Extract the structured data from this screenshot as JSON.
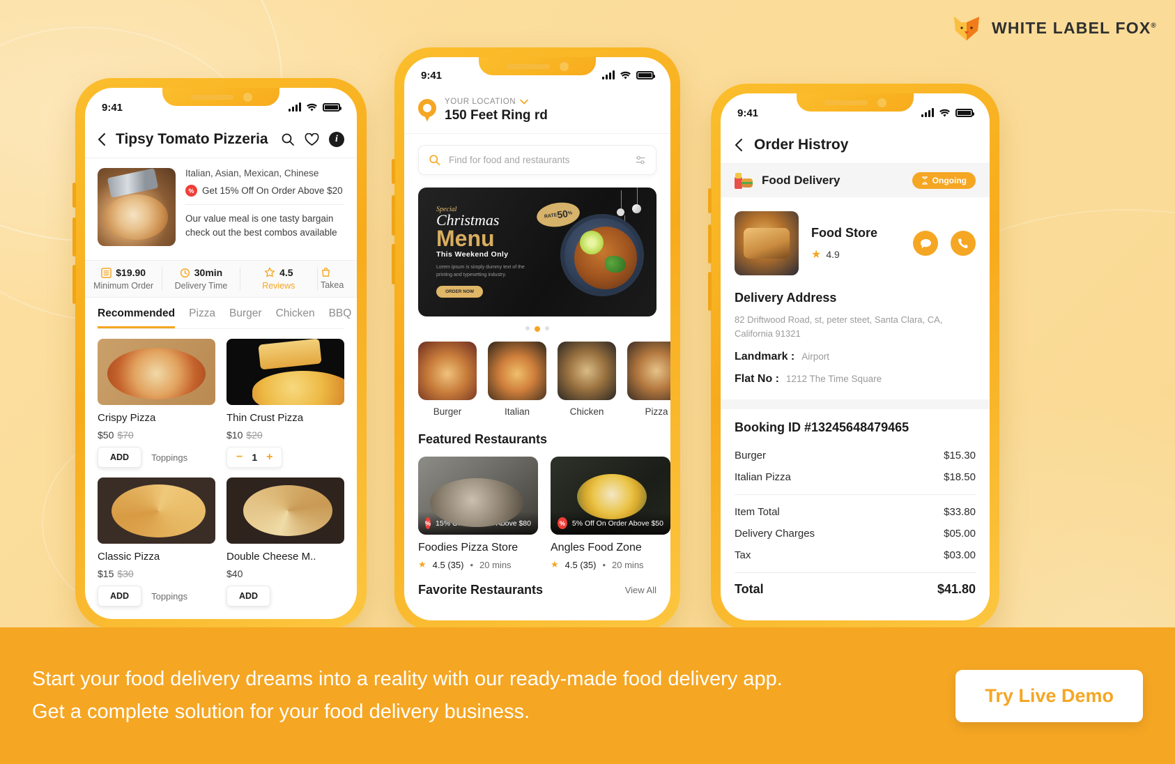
{
  "brand": {
    "name": "WHITE LABEL FOX",
    "trademark": "®"
  },
  "footer": {
    "line1": "Start your food delivery dreams into a reality with our ready-made food delivery app.",
    "line2": "Get a complete solution for your food delivery business.",
    "cta": "Try Live Demo"
  },
  "phone1": {
    "status_time": "9:41",
    "title": "Tipsy Tomato Pizzeria",
    "cuisines": "Italian, Asian, Mexican, Chinese",
    "offer": "Get 15% Off On Order Above $20",
    "description": "Our value meal is one tasty bargain check out the best combos available",
    "stats": [
      {
        "value": "$19.90",
        "label": "Minimum Order",
        "icon": "list-icon"
      },
      {
        "value": "30min",
        "label": "Delivery Time",
        "icon": "clock-icon"
      },
      {
        "value": "4.5",
        "label": "Reviews",
        "icon": "star-icon"
      },
      {
        "value": "",
        "label": "Takea",
        "icon": "bag-icon"
      }
    ],
    "tabs": [
      "Recommended",
      "Pizza",
      "Burger",
      "Chicken",
      "BBQ"
    ],
    "active_tab": "Recommended",
    "dishes": [
      {
        "name": "Crispy Pizza",
        "price": "$50",
        "old_price": "$70",
        "action": "ADD",
        "extra": "Toppings"
      },
      {
        "name": "Thin Crust Pizza",
        "price": "$10",
        "old_price": "$20",
        "action": "stepper",
        "qty": "1"
      },
      {
        "name": "Classic Pizza",
        "price": "$15",
        "old_price": "$30",
        "action": "ADD",
        "extra": "Toppings"
      },
      {
        "name": "Double Cheese M..",
        "price": "$40",
        "old_price": "",
        "action": "ADD",
        "extra": ""
      }
    ]
  },
  "phone2": {
    "status_time": "9:41",
    "location_label": "YOUR LOCATION",
    "location_value": "150 Feet Ring rd",
    "search_placeholder": "Find for food and restaurants",
    "banner": {
      "special": "Special",
      "christmas": "Christmas",
      "menu": "Menu",
      "weekend": "This Weekend Only",
      "lorem": "Lorem ipsum is simply dummy text of the printing and typesetting industry.",
      "button": "ORDER NOW",
      "rate_small": "RATE",
      "rate_big": "50",
      "rate_pct": "%"
    },
    "carousel_dots": 3,
    "carousel_active": 1,
    "categories": [
      {
        "label": "Burger"
      },
      {
        "label": "Italian"
      },
      {
        "label": "Chicken"
      },
      {
        "label": "Pizza"
      }
    ],
    "featured_title": "Featured Restaurants",
    "restaurants": [
      {
        "name": "Foodies Pizza Store",
        "offer": "15% Off On Order Above $80",
        "rating": "4.5 (35)",
        "time": "20 mins"
      },
      {
        "name": "Angles Food Zone",
        "offer": "5% Off On Order Above $50",
        "rating": "4.5 (35)",
        "time": "20 mins"
      }
    ],
    "favorite_title": "Favorite Restaurants",
    "view_all": "View All"
  },
  "phone3": {
    "status_time": "9:41",
    "title": "Order Histroy",
    "order_type": "Food Delivery",
    "status_badge": "Ongoing",
    "store_name": "Food Store",
    "store_rating": "4.9",
    "address_title": "Delivery Address",
    "address_text": "82  Driftwood Road, st, peter steet, Santa Clara, CA, California 91321",
    "landmark_key": "Landmark  :",
    "landmark_value": "Airport",
    "flat_key": "Flat No :",
    "flat_value": "1212 The Time Square",
    "booking_id": "Booking ID #13245648479465",
    "items": [
      {
        "label": "Burger",
        "amount": "$15.30"
      },
      {
        "label": "Italian Pizza",
        "amount": "$18.50"
      }
    ],
    "charges": [
      {
        "label": "Item Total",
        "amount": "$33.80"
      },
      {
        "label": "Delivery Charges",
        "amount": "$05.00"
      },
      {
        "label": "Tax",
        "amount": "$03.00"
      }
    ],
    "total_label": "Total",
    "total_amount": "$41.80"
  }
}
